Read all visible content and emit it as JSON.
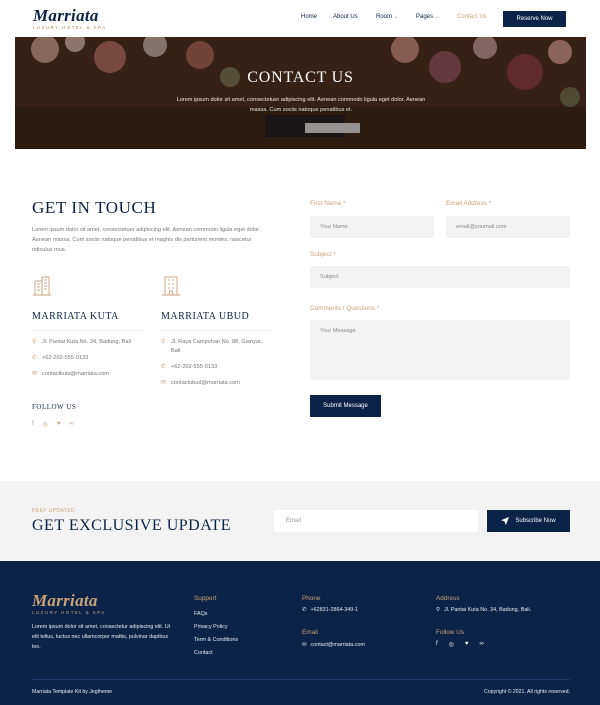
{
  "header": {
    "logo": "Marriata",
    "logo_sub": "LUXURY HOTEL & SPA",
    "nav": [
      "Home",
      "About Us",
      "Room",
      "Pages",
      "Contact Us"
    ],
    "reserve": "Reserve Now"
  },
  "hero": {
    "title": "CONTACT US",
    "text": "Lorem ipsum dolor sit amet, consectetuer adipiscing elit. Aenean commodo ligula eget dolor. Aenean massa. Cum sociis natoque penatibus et."
  },
  "touch": {
    "title": "GET IN TOUCH",
    "text": "Lorem ipsum dolor sit amet, consectetuer adipiscing elit. Aenean commodo ligula eget dolor. Aenean massa. Cum sociis natoque penatibus et magnis dis parturient montes, nascetur ridiculus mus.",
    "locations": [
      {
        "name": "MARRIATA KUTA",
        "address": "Jl. Pantai Kuta No. 34, Badung, Bali",
        "phone": "+62-202-555-0133",
        "email": "contactkuta@marriata.com"
      },
      {
        "name": "MARRIATA UBUD",
        "address": "Jl. Raya Campuhan No. 88, Gianyar, Bali",
        "phone": "+62-202-555-0133",
        "email": "contactubud@marriata.com"
      }
    ],
    "follow": "FOLLOW US"
  },
  "form": {
    "first_name_label": "First Name",
    "first_name_placeholder": "Your Name",
    "email_label": "Email Address",
    "email_placeholder": "email@youmail.com",
    "subject_label": "Subject",
    "subject_placeholder": "Subject",
    "comments_label": "Comments / Questions",
    "comments_placeholder": "Your Message",
    "required_mark": "*",
    "submit": "Submit Message"
  },
  "newsletter": {
    "kicker": "KEEP UPDATED",
    "title": "GET EXCLUSIVE UPDATE",
    "placeholder": "Email",
    "button": "Subscribe Now"
  },
  "footer": {
    "logo": "Marriata",
    "logo_sub": "LUXURY HOTEL & SPA",
    "about": "Lorem ipsum dolor sit amet, consectetur adipiscing elit. Ut elit tellus, luctus nec ullamcorper mattis, pulvinar dapibus leo.",
    "support_title": "Support",
    "support_links": [
      "FAQs",
      "Privacy Policy",
      "Term & Conditions",
      "Contact"
    ],
    "phone_title": "Phone",
    "phone": "+62831-2864-349-1",
    "email_title": "Email",
    "email": "contact@marriata.com",
    "address_title": "Address",
    "address": "Jl. Pantai Kuta No. 34, Badung, Bali.",
    "follow_title": "Follow Us",
    "credit": "Marriata Template Kit by Jegtheme",
    "copyright": "Copyright © 2021. All rights reserved."
  },
  "colors": {
    "navy": "#0b2346",
    "gold": "#c8a27a",
    "light_bg": "#f3f3f3"
  }
}
